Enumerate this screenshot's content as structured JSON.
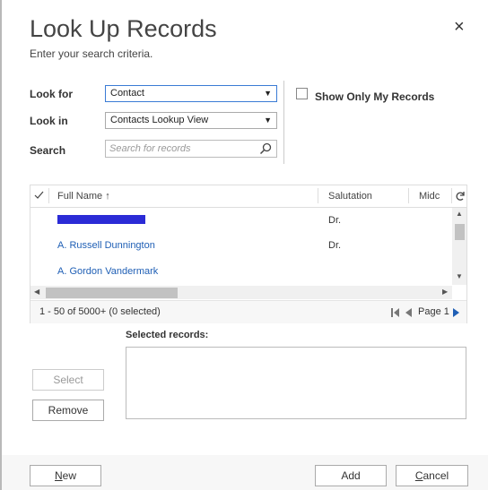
{
  "dialog": {
    "title": "Look Up Records",
    "subtitle": "Enter your search criteria.",
    "close_glyph": "×"
  },
  "form": {
    "look_for_label": "Look for",
    "look_for_value": "Contact",
    "look_in_label": "Look in",
    "look_in_value": "Contacts Lookup View",
    "search_label": "Search",
    "search_placeholder": "Search for records",
    "show_only_mine_label": "Show Only My Records"
  },
  "grid": {
    "columns": [
      "Full Name",
      "Salutation",
      "Midc"
    ],
    "sort_glyph": "↑",
    "rows": [
      {
        "name": "",
        "salutation": "Dr."
      },
      {
        "name": "A. Russell Dunnington",
        "salutation": "Dr."
      },
      {
        "name": "A. Gordon Vandermark",
        "salutation": ""
      }
    ],
    "record_count": "1 - 50 of 5000+ (0 selected)",
    "page_label": "Page 1"
  },
  "selected": {
    "label": "Selected records:"
  },
  "buttons": {
    "select": "Select",
    "remove": "Remove",
    "new": "New",
    "add": "Add",
    "cancel": "Cancel"
  },
  "colors": {
    "accent": "#1f5fb5",
    "redaction": "#2b2bd6",
    "focus_border": "#3a7bd5"
  },
  "icons": [
    "close-icon",
    "chevron-down-icon",
    "search-icon",
    "checkmark-icon",
    "sort-up-icon",
    "refresh-icon",
    "first-page-icon",
    "prev-page-icon",
    "next-page-icon"
  ]
}
